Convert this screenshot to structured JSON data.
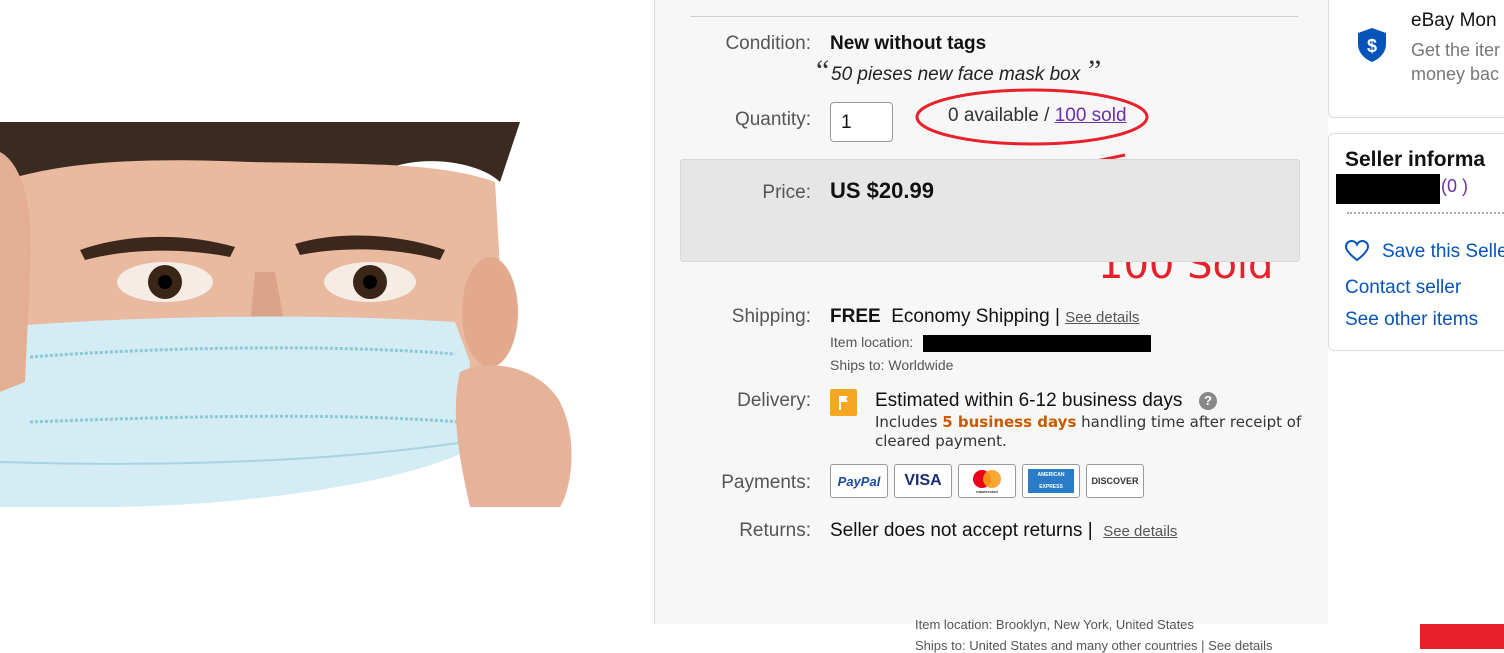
{
  "listing": {
    "condition_label": "Condition:",
    "condition_value": "New without tags",
    "condition_quote_open": "“",
    "condition_note": "50 pieses new face mask box",
    "condition_quote_close": "”",
    "quantity_label": "Quantity:",
    "quantity_value": "1",
    "available_text": "0 available / ",
    "sold_text": "100 sold",
    "price_label": "Price:",
    "price_value": "US $20.99",
    "shipping_label": "Shipping:",
    "shipping_free": "FREE",
    "shipping_method": "Economy Shipping |",
    "see_details": "See details",
    "item_location_label": "Item location:",
    "ships_to": "Ships to:  Worldwide",
    "delivery_label": "Delivery:",
    "delivery_estimate": "Estimated within 6-12 business days",
    "delivery_includes": "Includes ",
    "delivery_days": "5 business days",
    "delivery_rest1": " handling time after receipt of",
    "delivery_rest2": "cleared payment.",
    "payments_label": "Payments:",
    "payments": [
      "PayPal",
      "VISA",
      "mastercard",
      "AMERICAN EXPRESS",
      "DISCOVER"
    ],
    "returns_label": "Returns:",
    "returns_value": "Seller does not accept returns |",
    "returns_see_details": "See details"
  },
  "annotation": {
    "text": "100 Sold",
    "color": "#e8202a"
  },
  "right_column": {
    "guarantee_title": "eBay Mon",
    "guarantee_line1": "Get the iter",
    "guarantee_line2": "money bac",
    "seller_title": "Seller informa",
    "feedback": "(0 )",
    "save_seller": "Save this Selle",
    "contact_seller": "Contact seller",
    "see_other_items": "See other items"
  },
  "bottom_strip": {
    "item_location": "Item location:  Brooklyn, New York, United States",
    "ships_to": "Ships to:  United States and many other countries | See details"
  },
  "colors": {
    "link_blue": "#0654ba",
    "sold_purple": "#6b2fa8",
    "orange": "#f5a623",
    "red": "#e8202a"
  }
}
